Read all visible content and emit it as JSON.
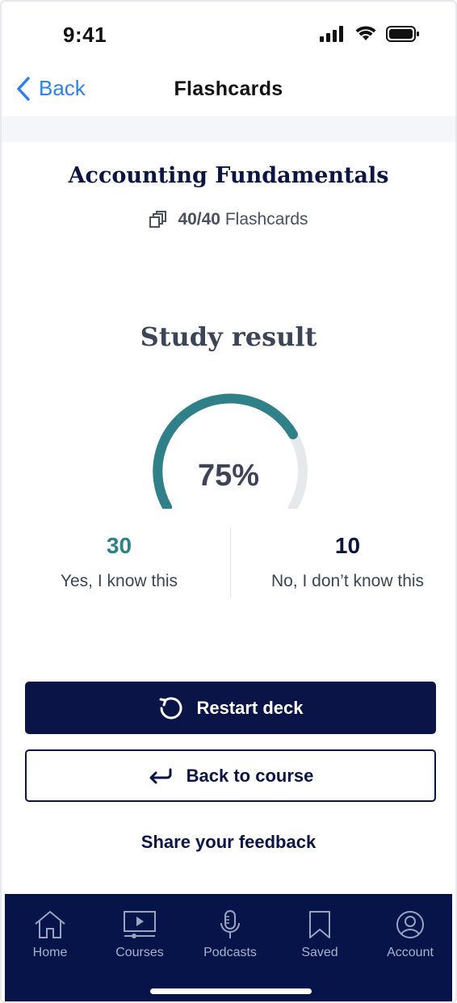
{
  "status_bar": {
    "time": "9:41"
  },
  "nav": {
    "back_label": "Back",
    "title": "Flashcards"
  },
  "deck": {
    "title": "Accounting Fundamentals",
    "count_strong": "40/40",
    "count_suffix": "Flashcards"
  },
  "result": {
    "title": "Study result",
    "percent_label": "75%",
    "percent_value": 0.75,
    "known_count": "30",
    "known_label": "Yes, I know this",
    "unknown_count": "10",
    "unknown_label": "No, I don’t know this"
  },
  "actions": {
    "restart_label": "Restart deck",
    "back_to_course_label": "Back to course",
    "feedback_label": "Share your feedback"
  },
  "tabbar": {
    "items": [
      {
        "label": "Home",
        "icon": "home-icon"
      },
      {
        "label": "Courses",
        "icon": "video-course-icon"
      },
      {
        "label": "Podcasts",
        "icon": "microphone-icon"
      },
      {
        "label": "Saved",
        "icon": "bookmark-icon"
      },
      {
        "label": "Account",
        "icon": "user-icon"
      }
    ]
  },
  "colors": {
    "brand_navy": "#0b1446",
    "accent_teal": "#2f8088",
    "link_blue": "#2f80ed",
    "gauge_track": "#e6e8ec"
  }
}
